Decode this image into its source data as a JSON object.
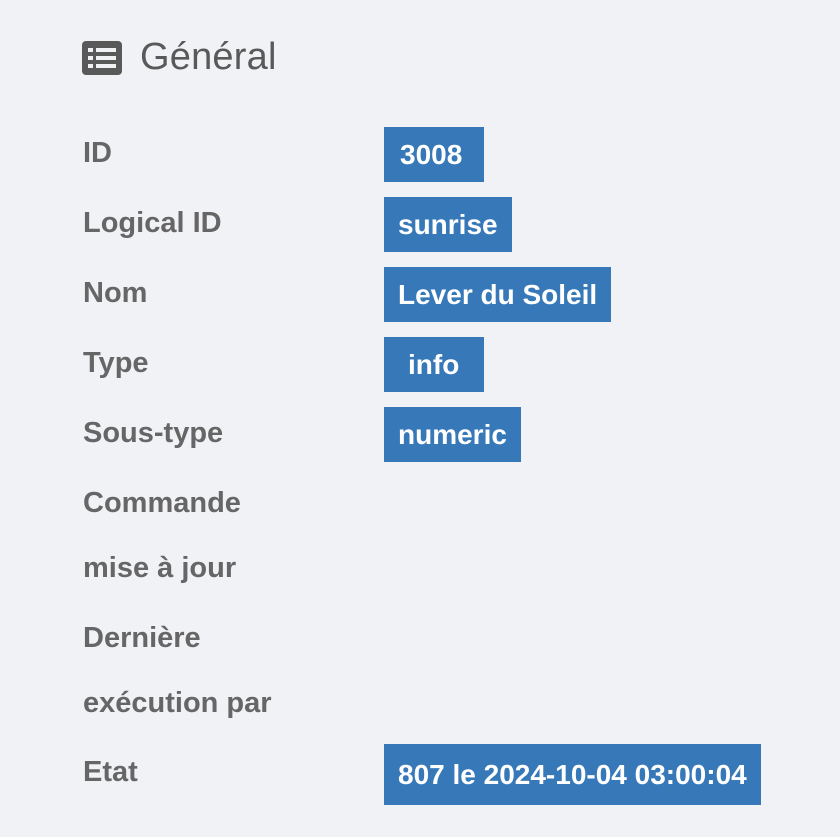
{
  "section": {
    "title": "Général",
    "icon": "list-icon"
  },
  "fields": [
    {
      "key": "id",
      "label": "ID",
      "value": "3008"
    },
    {
      "key": "logical_id",
      "label": "Logical ID",
      "value": "sunrise"
    },
    {
      "key": "nom",
      "label": "Nom",
      "value": "Lever du Soleil"
    },
    {
      "key": "type",
      "label": "Type",
      "value": "info"
    },
    {
      "key": "sous_type",
      "label": "Sous-type",
      "value": "numeric"
    },
    {
      "key": "commande_maj",
      "label": "Commande",
      "value": ""
    },
    {
      "key": "commande_maj_2",
      "label": "mise à jour",
      "value": ""
    },
    {
      "key": "derniere_exec",
      "label": "Dernière",
      "value": ""
    },
    {
      "key": "derniere_exec_2",
      "label": "exécution par",
      "value": ""
    },
    {
      "key": "etat",
      "label": "Etat",
      "value": "807 le 2024-10-04 03:00:04"
    }
  ],
  "colors": {
    "badge_bg": "#3779b8",
    "badge_text": "#ffffff",
    "label_text": "#666666",
    "background": "#f0f2f5"
  }
}
